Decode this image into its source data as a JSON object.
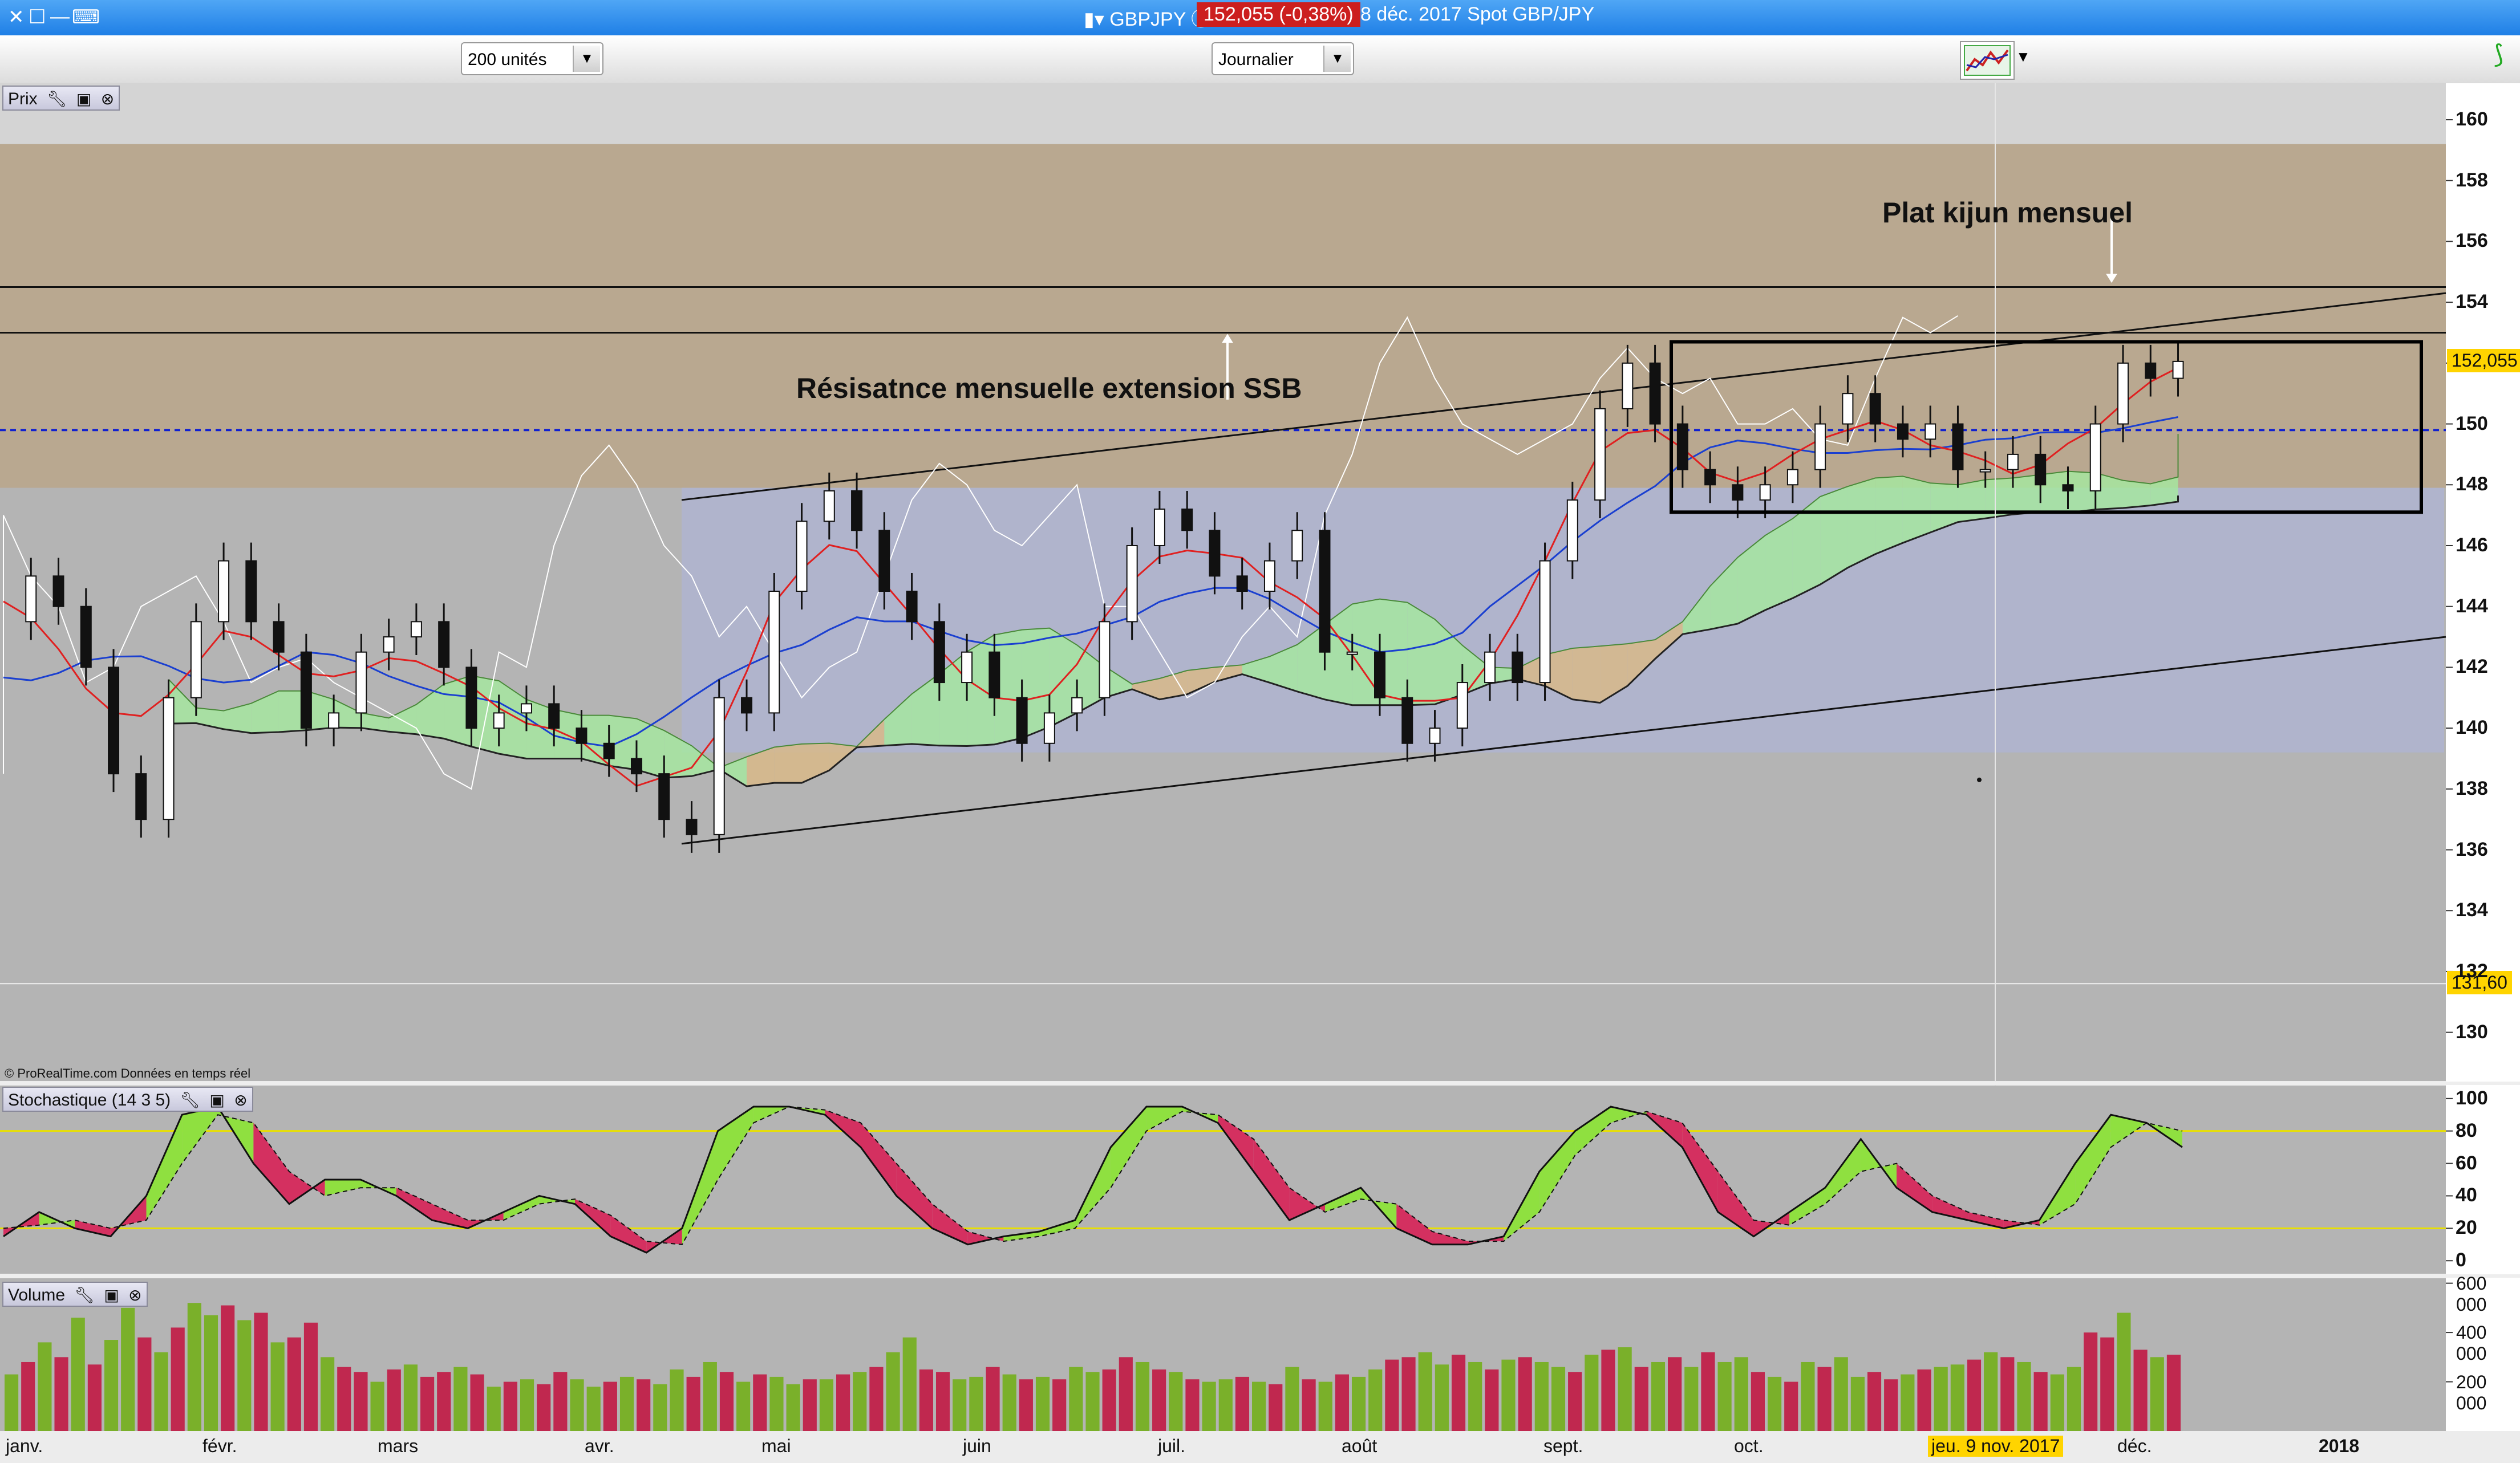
{
  "window": {
    "title": "GBPJPY",
    "price_badge": "152,055 (-0,38%)",
    "date_info": "8 déc. 2017 Spot GBP/JPY"
  },
  "toolbar": {
    "units_select": "200 unités",
    "period_select": "Journalier"
  },
  "panels": {
    "price_label": "Prix",
    "stoch_label": "Stochastique (14 3 5)",
    "volume_label": "Volume",
    "copyright": "© ProRealTime.com  Données en temps réel"
  },
  "annotations": {
    "ssb": "Résisatnce mensuelle extension SSB",
    "kijun": "Plat kijun mensuel"
  },
  "colors": {
    "bull_volume": "#7ab02a",
    "bear_volume": "#c0284f",
    "cloud_bull": "#a6e6a0",
    "cloud_bear": "#d8b888",
    "tenkan": "#e02020",
    "kijun": "#1a3fd0",
    "chikou": "#ffffff"
  },
  "chart_data": [
    {
      "type": "line",
      "name": "price",
      "x_ticks": [
        "janv.",
        "févr.",
        "mars",
        "avr.",
        "mai",
        "juin",
        "juil.",
        "août",
        "sept.",
        "oct.",
        "jeu. 9 nov. 2017",
        "déc.",
        "2018"
      ],
      "y_ticks": [
        130,
        132,
        134,
        136,
        138,
        140,
        142,
        144,
        146,
        148,
        150,
        152,
        154,
        156,
        158,
        160
      ],
      "y_tick_labels": [
        "130",
        "132",
        "134",
        "136",
        "138",
        "140",
        "142",
        "144",
        "146",
        "148",
        "150",
        "152,055",
        "154",
        "156",
        "158",
        "160"
      ],
      "ylim": [
        128.4,
        161.2
      ],
      "current_price_label": "152,055",
      "marker_label": "131,60",
      "horizontal_lines": [
        154.5,
        153.0
      ],
      "dashed_line": 149.8,
      "series": [
        {
          "name": "",
          "values": [
            143.5,
            145.0,
            144.0,
            142.0,
            138.5,
            137.0,
            141.0,
            143.5,
            145.5,
            143.5,
            142.5,
            140.0,
            140.5,
            142.5,
            143.0,
            143.5,
            142.0,
            140.0,
            140.5,
            140.8,
            140.0,
            139.5,
            139.0,
            138.5,
            137.0,
            136.5,
            141.0,
            140.5,
            144.5,
            146.8,
            147.8,
            146.5,
            144.5,
            143.5,
            141.5,
            142.5,
            141.0,
            139.5,
            140.5,
            141.0,
            143.5,
            146.0,
            147.2,
            146.5,
            145.0,
            144.5,
            145.5,
            146.5,
            142.5,
            142.5,
            141.0,
            139.5,
            140.0,
            141.5,
            142.5,
            141.5,
            145.5,
            147.5,
            150.5,
            152.0,
            150.0,
            148.5,
            148.0,
            147.5,
            148.0,
            148.5,
            150.0,
            151.0,
            150.0,
            149.5,
            150.0,
            148.5,
            148.5,
            149.0,
            148.0,
            147.8,
            150.0,
            152.0,
            151.5,
            152.055
          ]
        }
      ]
    },
    {
      "type": "line",
      "name": "stochastic",
      "y_ticks": [
        0,
        20,
        40,
        60,
        80,
        100
      ],
      "ylim": [
        -8,
        108
      ],
      "reference_lines": [
        20,
        80
      ],
      "series": [
        {
          "name": "",
          "values": [
            15,
            30,
            20,
            15,
            40,
            90,
            95,
            60,
            35,
            50,
            50,
            40,
            25,
            20,
            30,
            40,
            35,
            15,
            5,
            20,
            80,
            95,
            95,
            90,
            70,
            40,
            20,
            10,
            15,
            18,
            25,
            70,
            95,
            95,
            85,
            55,
            25,
            35,
            45,
            20,
            10,
            10,
            15,
            55,
            80,
            95,
            90,
            70,
            30,
            15,
            30,
            45,
            75,
            45,
            30,
            25,
            20,
            25,
            60,
            90,
            85,
            70
          ]
        },
        {
          "name": "",
          "values": [
            20,
            22,
            25,
            20,
            25,
            60,
            90,
            85,
            55,
            40,
            45,
            45,
            35,
            25,
            25,
            35,
            38,
            28,
            12,
            10,
            50,
            85,
            95,
            93,
            85,
            60,
            35,
            18,
            12,
            15,
            20,
            45,
            80,
            92,
            90,
            75,
            45,
            30,
            38,
            35,
            18,
            12,
            12,
            30,
            65,
            85,
            92,
            85,
            55,
            25,
            22,
            35,
            55,
            60,
            40,
            30,
            25,
            22,
            35,
            70,
            85,
            80
          ]
        }
      ]
    },
    {
      "type": "bar",
      "name": "volume",
      "y_ticks": [
        200000,
        400000,
        600000
      ],
      "y_tick_labels": [
        "200 000",
        "400 000",
        "600 000"
      ],
      "ylim": [
        0,
        620000
      ],
      "values": [
        230000,
        280000,
        360000,
        300000,
        460000,
        270000,
        370000,
        500000,
        380000,
        320000,
        420000,
        520000,
        470000,
        510000,
        450000,
        480000,
        360000,
        380000,
        440000,
        300000,
        260000,
        240000,
        200000,
        250000,
        270000,
        220000,
        240000,
        260000,
        230000,
        180000,
        200000,
        210000,
        190000,
        240000,
        210000,
        180000,
        200000,
        220000,
        210000,
        190000,
        250000,
        220000,
        280000,
        240000,
        200000,
        230000,
        220000,
        190000,
        210000,
        210000,
        230000,
        240000,
        260000,
        320000,
        380000,
        250000,
        240000,
        210000,
        220000,
        260000,
        230000,
        210000,
        220000,
        210000,
        260000,
        240000,
        250000,
        300000,
        280000,
        250000,
        240000,
        210000,
        200000,
        210000,
        220000,
        200000,
        190000,
        260000,
        210000,
        200000,
        230000,
        220000,
        250000,
        290000,
        300000,
        320000,
        270000,
        310000,
        280000,
        250000,
        290000,
        300000,
        280000,
        260000,
        240000,
        310000,
        330000,
        340000,
        260000,
        280000,
        300000,
        260000,
        320000,
        280000,
        300000,
        240000,
        220000,
        200000,
        280000,
        260000,
        300000,
        220000,
        240000,
        210000,
        230000,
        250000,
        260000,
        270000,
        290000,
        320000,
        300000,
        280000,
        240000,
        230000,
        260000,
        400000,
        380000,
        480000,
        330000,
        300000,
        310000
      ],
      "bullish": [
        true,
        false,
        true,
        false,
        true,
        false,
        true,
        true,
        false,
        true,
        false,
        true,
        true,
        false,
        true,
        false,
        true,
        false,
        false,
        true,
        false,
        false,
        true,
        false,
        true,
        false,
        false,
        true,
        false,
        true,
        false,
        true,
        false,
        false,
        true,
        true,
        false,
        true,
        false,
        true,
        true,
        false,
        true,
        false,
        true,
        false,
        true,
        true,
        false,
        true,
        false,
        true,
        false,
        true,
        true,
        false,
        false,
        true,
        true,
        false,
        true,
        false,
        true,
        false,
        true,
        true,
        false,
        false,
        true,
        false,
        true,
        false,
        true,
        true,
        false,
        true,
        false,
        true,
        false,
        true,
        false,
        true,
        true,
        false,
        false,
        true,
        true,
        false,
        true,
        false,
        true,
        false,
        true,
        true,
        false,
        true,
        false,
        true,
        false,
        true,
        false,
        true,
        false,
        true,
        true,
        false,
        true,
        false,
        true,
        false,
        true,
        true,
        false,
        false,
        true,
        false,
        true,
        true,
        false,
        true,
        false,
        true,
        false,
        true,
        true,
        false,
        false,
        true,
        false,
        true,
        false
      ]
    }
  ]
}
